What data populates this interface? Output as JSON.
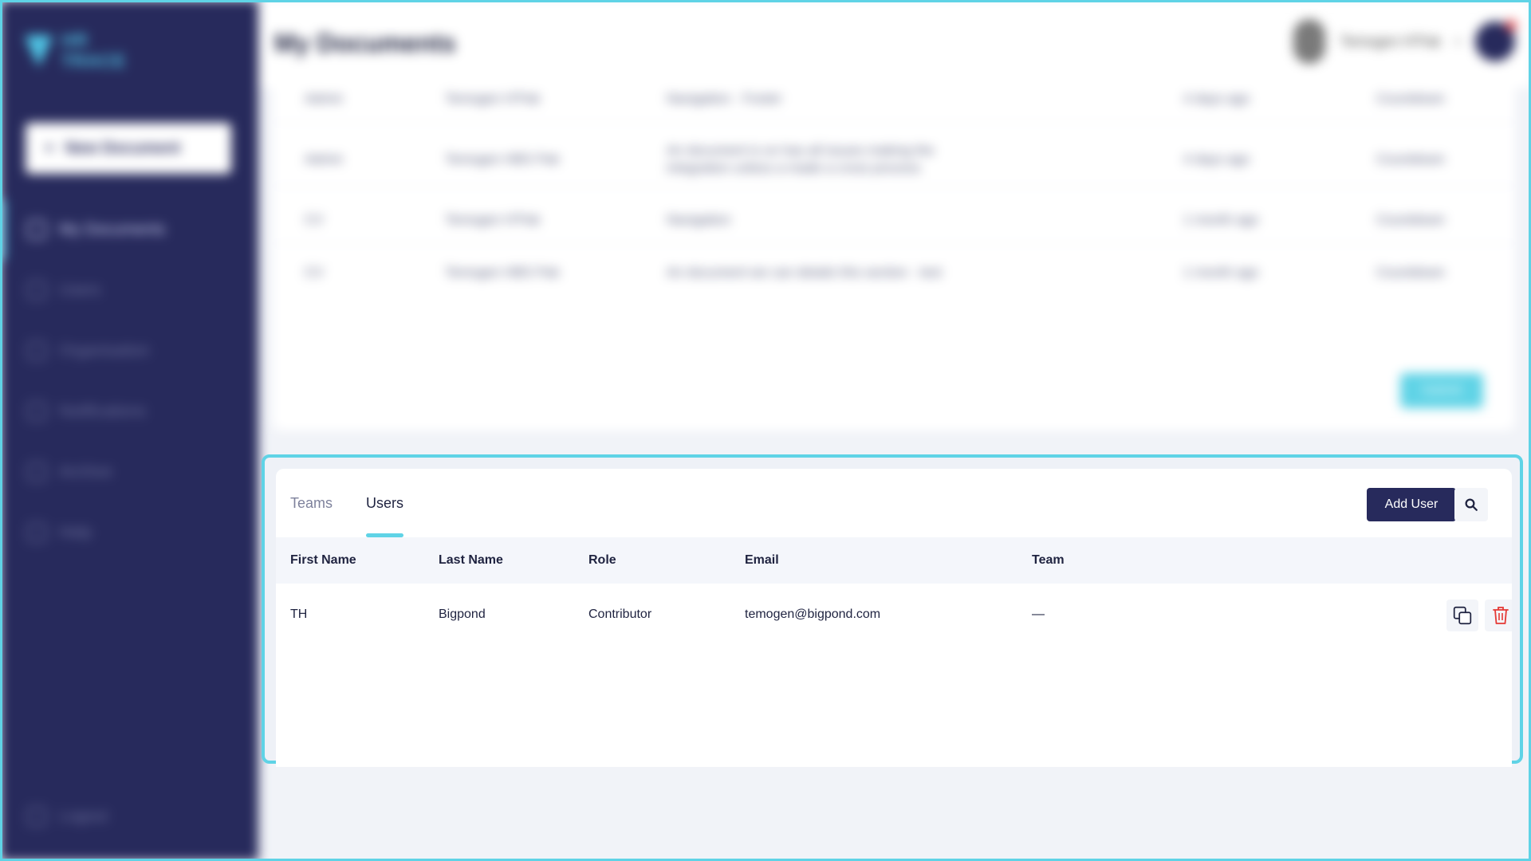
{
  "app": {
    "logo_text": "HR TRACE",
    "page_title": "My Documents"
  },
  "sidebar": {
    "new_document_label": "New Document",
    "items": [
      {
        "label": "My Documents"
      },
      {
        "label": "Users"
      },
      {
        "label": "Organisation"
      },
      {
        "label": "Notifications"
      },
      {
        "label": "Archive"
      },
      {
        "label": "Help"
      }
    ],
    "logout_label": "Logout"
  },
  "header": {
    "user_name": "Temogen H'Pak"
  },
  "documents": {
    "rows": [
      {
        "type": "Admin",
        "owner": "Temogen H'Pak",
        "description": "Navigation · Footer",
        "age": "4 days ago",
        "status": "Countdown"
      },
      {
        "type": "Admin",
        "owner": "Temogen HBS Pak",
        "description": "An document is on has all issues making the integration unless a made a cross process",
        "age": "4 days ago",
        "status": "Countdown"
      },
      {
        "type": "CV",
        "owner": "Temogen H'Pak",
        "description": "Navigation",
        "age": "1 month ago",
        "status": "Countdown"
      },
      {
        "type": "CV",
        "owner": "Temogen HBS Pak",
        "description": "An document we can details this section · test",
        "age": "1 month ago",
        "status": "Countdown"
      }
    ],
    "submit_label": "Submit"
  },
  "users_panel": {
    "tabs": [
      {
        "label": "Teams",
        "active": false
      },
      {
        "label": "Users",
        "active": true
      }
    ],
    "add_user_label": "Add User",
    "columns": [
      "First Name",
      "Last Name",
      "Role",
      "Email",
      "Team"
    ],
    "rows": [
      {
        "first_name": "TH",
        "last_name": "Bigpond",
        "role": "Contributor",
        "email": "temogen@bigpond.com",
        "team": "—"
      }
    ]
  },
  "colors": {
    "sidebar_bg": "#272a5c",
    "accent": "#5fd3e6",
    "primary_button": "#272a5c",
    "delete": "#e53935"
  },
  "icons": [
    "search-icon",
    "copy-icon",
    "trash-icon",
    "chevron-down-icon"
  ]
}
